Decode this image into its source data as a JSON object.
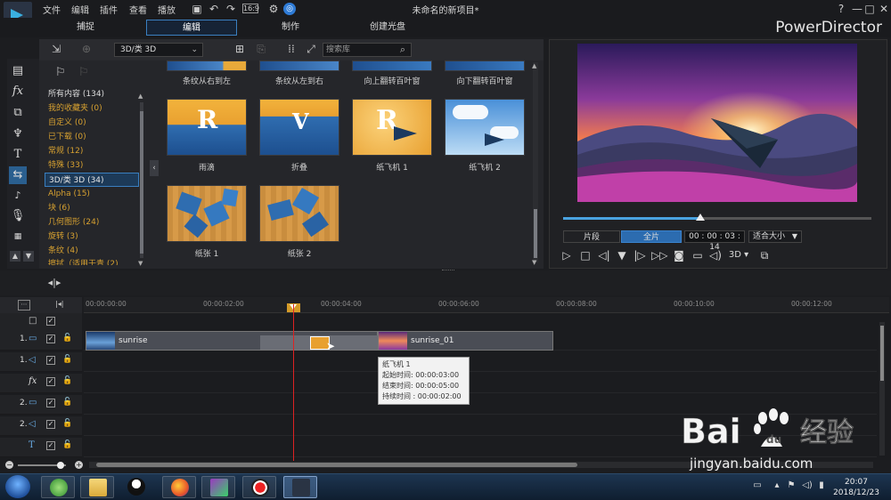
{
  "window": {
    "menu": [
      "文件",
      "编辑",
      "插件",
      "查看",
      "播放"
    ],
    "title": "未命名的新项目*",
    "help": "?",
    "min": "—",
    "max": "□",
    "close": "✕"
  },
  "mode_tabs": [
    {
      "label": "捕捉",
      "active": false
    },
    {
      "label": "编辑",
      "active": true
    },
    {
      "label": "制作",
      "active": false
    },
    {
      "label": "创建光盘",
      "active": false
    }
  ],
  "brand": "PowerDirector",
  "library": {
    "category_select": "3D/类 3D",
    "search_placeholder": "搜索库",
    "categories": [
      {
        "label": "所有内容 (134)",
        "style": "white"
      },
      {
        "label": "我的收藏夹 (0)",
        "style": "orange"
      },
      {
        "label": "自定义 (0)",
        "style": "orange"
      },
      {
        "label": "已下载 (0)",
        "style": "orange"
      },
      {
        "label": "常规 (12)",
        "style": "orange"
      },
      {
        "label": "特殊 (33)",
        "style": "orange"
      },
      {
        "label": "3D/类 3D (34)",
        "style": "selected"
      },
      {
        "label": "Alpha (15)",
        "style": "orange"
      },
      {
        "label": "块 (6)",
        "style": "orange"
      },
      {
        "label": "几何图形 (24)",
        "style": "orange"
      },
      {
        "label": "旋转 (3)",
        "style": "orange"
      },
      {
        "label": "条纹 (4)",
        "style": "orange"
      },
      {
        "label": "擦拭（适用于青 (2)",
        "style": "orange"
      }
    ],
    "top_row_captions": [
      "条纹从右到左",
      "条纹从左到右",
      "向上翻转百叶窗",
      "向下翻转百叶窗"
    ],
    "thumbnails": [
      {
        "caption": "雨滴",
        "kind": "rain"
      },
      {
        "caption": "折叠",
        "kind": "fold"
      },
      {
        "caption": "纸飞机 1",
        "kind": "plane1"
      },
      {
        "caption": "纸飞机 2",
        "kind": "plane2"
      },
      {
        "caption": "纸张 1",
        "kind": "paper1"
      },
      {
        "caption": "纸张 2",
        "kind": "paper2"
      }
    ]
  },
  "preview": {
    "clip_btn": "片段",
    "movie_btn": "全片",
    "timecode": "00 : 00 : 03 : 14",
    "fit": "适合大小",
    "mode_3d": "3D",
    "progress_fraction": 0.44
  },
  "timeline": {
    "ruler": [
      "00:00:00:00",
      "00:00:02:00",
      "00:00:04:00",
      "00:00:06:00",
      "00:00:08:00",
      "00:00:10:00",
      "00:00:12:00"
    ],
    "tracks": [
      {
        "num": "",
        "icon": "□",
        "kind": "master"
      },
      {
        "num": "1.",
        "icon": "▭",
        "kind": "video"
      },
      {
        "num": "1.",
        "icon": "◁",
        "kind": "audio"
      },
      {
        "num": "",
        "icon": "fx",
        "kind": "fx"
      },
      {
        "num": "2.",
        "icon": "▭",
        "kind": "video"
      },
      {
        "num": "2.",
        "icon": "◁",
        "kind": "audio"
      },
      {
        "num": "",
        "icon": "T",
        "kind": "title"
      }
    ],
    "clips": [
      {
        "label": "sunrise"
      },
      {
        "label": "sunrise_01"
      }
    ],
    "tooltip": {
      "title": "纸飞机 1",
      "start": "起始时间: 00:00:03:00",
      "end": "结束时间: 00:00:05:00",
      "duration": "持续时间 :  00:00:02:00"
    }
  },
  "taskbar": {
    "time": "20:07",
    "date": "2018/12/23"
  },
  "watermark": {
    "logo": "Bai 经验",
    "url": "jingyan.baidu.com"
  }
}
